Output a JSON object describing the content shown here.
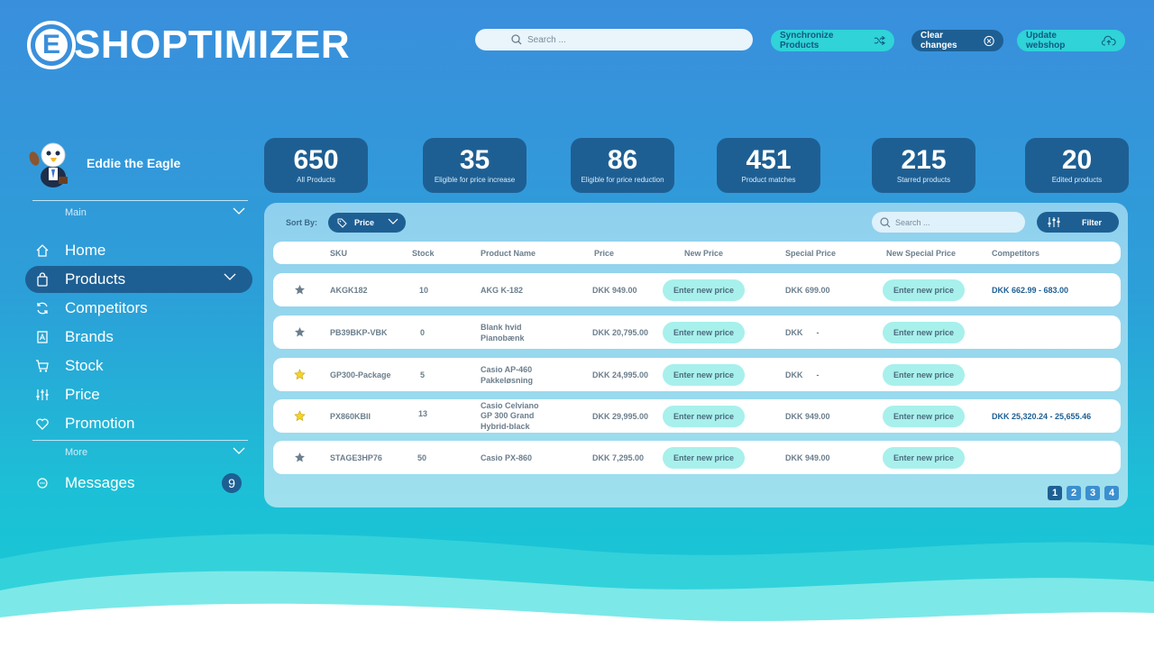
{
  "brand": {
    "logo_letter": "E",
    "logo_text": "SHOPTIMIZER"
  },
  "header": {
    "search_placeholder": "Search ...",
    "sync_label": "Synchronize Products",
    "clear_label": "Clear changes",
    "update_label": "Update webshop"
  },
  "profile": {
    "name": "Eddie the Eagle"
  },
  "sidebar": {
    "main_label": "Main",
    "more_label": "More",
    "items": [
      {
        "label": "Home",
        "icon": "home-icon"
      },
      {
        "label": "Products",
        "icon": "bag-icon",
        "active": true
      },
      {
        "label": "Competitors",
        "icon": "sync-icon"
      },
      {
        "label": "Brands",
        "icon": "brand-icon"
      },
      {
        "label": "Stock",
        "icon": "cart-icon"
      },
      {
        "label": "Price",
        "icon": "sliders-icon"
      },
      {
        "label": "Promotion",
        "icon": "heart-icon"
      }
    ],
    "messages": {
      "label": "Messages",
      "count": "9"
    }
  },
  "stats": [
    {
      "value": "650",
      "label": "All Products"
    },
    {
      "value": "35",
      "label": "Eligible for price increase"
    },
    {
      "value": "86",
      "label": "Eligible for price reduction"
    },
    {
      "value": "451",
      "label": "Product matches"
    },
    {
      "value": "215",
      "label": "Starred products"
    },
    {
      "value": "20",
      "label": "Edited products"
    }
  ],
  "toolbar": {
    "sort_by_label": "Sort By:",
    "sort_value": "Price",
    "search_placeholder": "Search ...",
    "filter_label": "Filter"
  },
  "table": {
    "columns": [
      "SKU",
      "Stock",
      "Product Name",
      "Price",
      "New Price",
      "Special Price",
      "New Special Price",
      "Competitors"
    ],
    "new_price_button": "Enter new price",
    "rows": [
      {
        "starred": false,
        "sku": "AKGK182",
        "stock": "10",
        "name": [
          "AKG K-182"
        ],
        "price": "DKK 949.00",
        "special": "DKK 699.00",
        "competitors": "DKK 662.99 -  683.00"
      },
      {
        "starred": false,
        "sku": "PB39BKP-VBK",
        "stock": "0",
        "name": [
          "Blank hvid",
          "Pianobænk"
        ],
        "price": "DKK 20,795.00",
        "special": "DKK      -",
        "competitors": ""
      },
      {
        "starred": true,
        "sku": "GP300-Package",
        "stock": "5",
        "name": [
          "Casio AP-460",
          "Pakkeløsning"
        ],
        "price": "DKK 24,995.00",
        "special": "DKK      -",
        "competitors": ""
      },
      {
        "starred": true,
        "sku": "PX860KBII",
        "stock": "13",
        "name": [
          "Casio Celviano",
          "GP 300 Grand",
          "Hybrid-black"
        ],
        "price": "DKK 29,995.00",
        "special": "DKK 949.00",
        "competitors": "DKK 25,320.24 - 25,655.46"
      },
      {
        "starred": false,
        "sku": "STAGE3HP76",
        "stock": "50",
        "name": [
          "Casio PX-860"
        ],
        "price": "DKK 7,295.00",
        "special": "DKK 949.00",
        "competitors": ""
      }
    ]
  },
  "pagination": {
    "pages": [
      "1",
      "2",
      "3",
      "4"
    ],
    "current": "1"
  },
  "colors": {
    "primary": "#1e5f93",
    "accent": "#2fd3d8",
    "star_active": "#f5d328",
    "star_inactive": "#6b7e8c"
  }
}
